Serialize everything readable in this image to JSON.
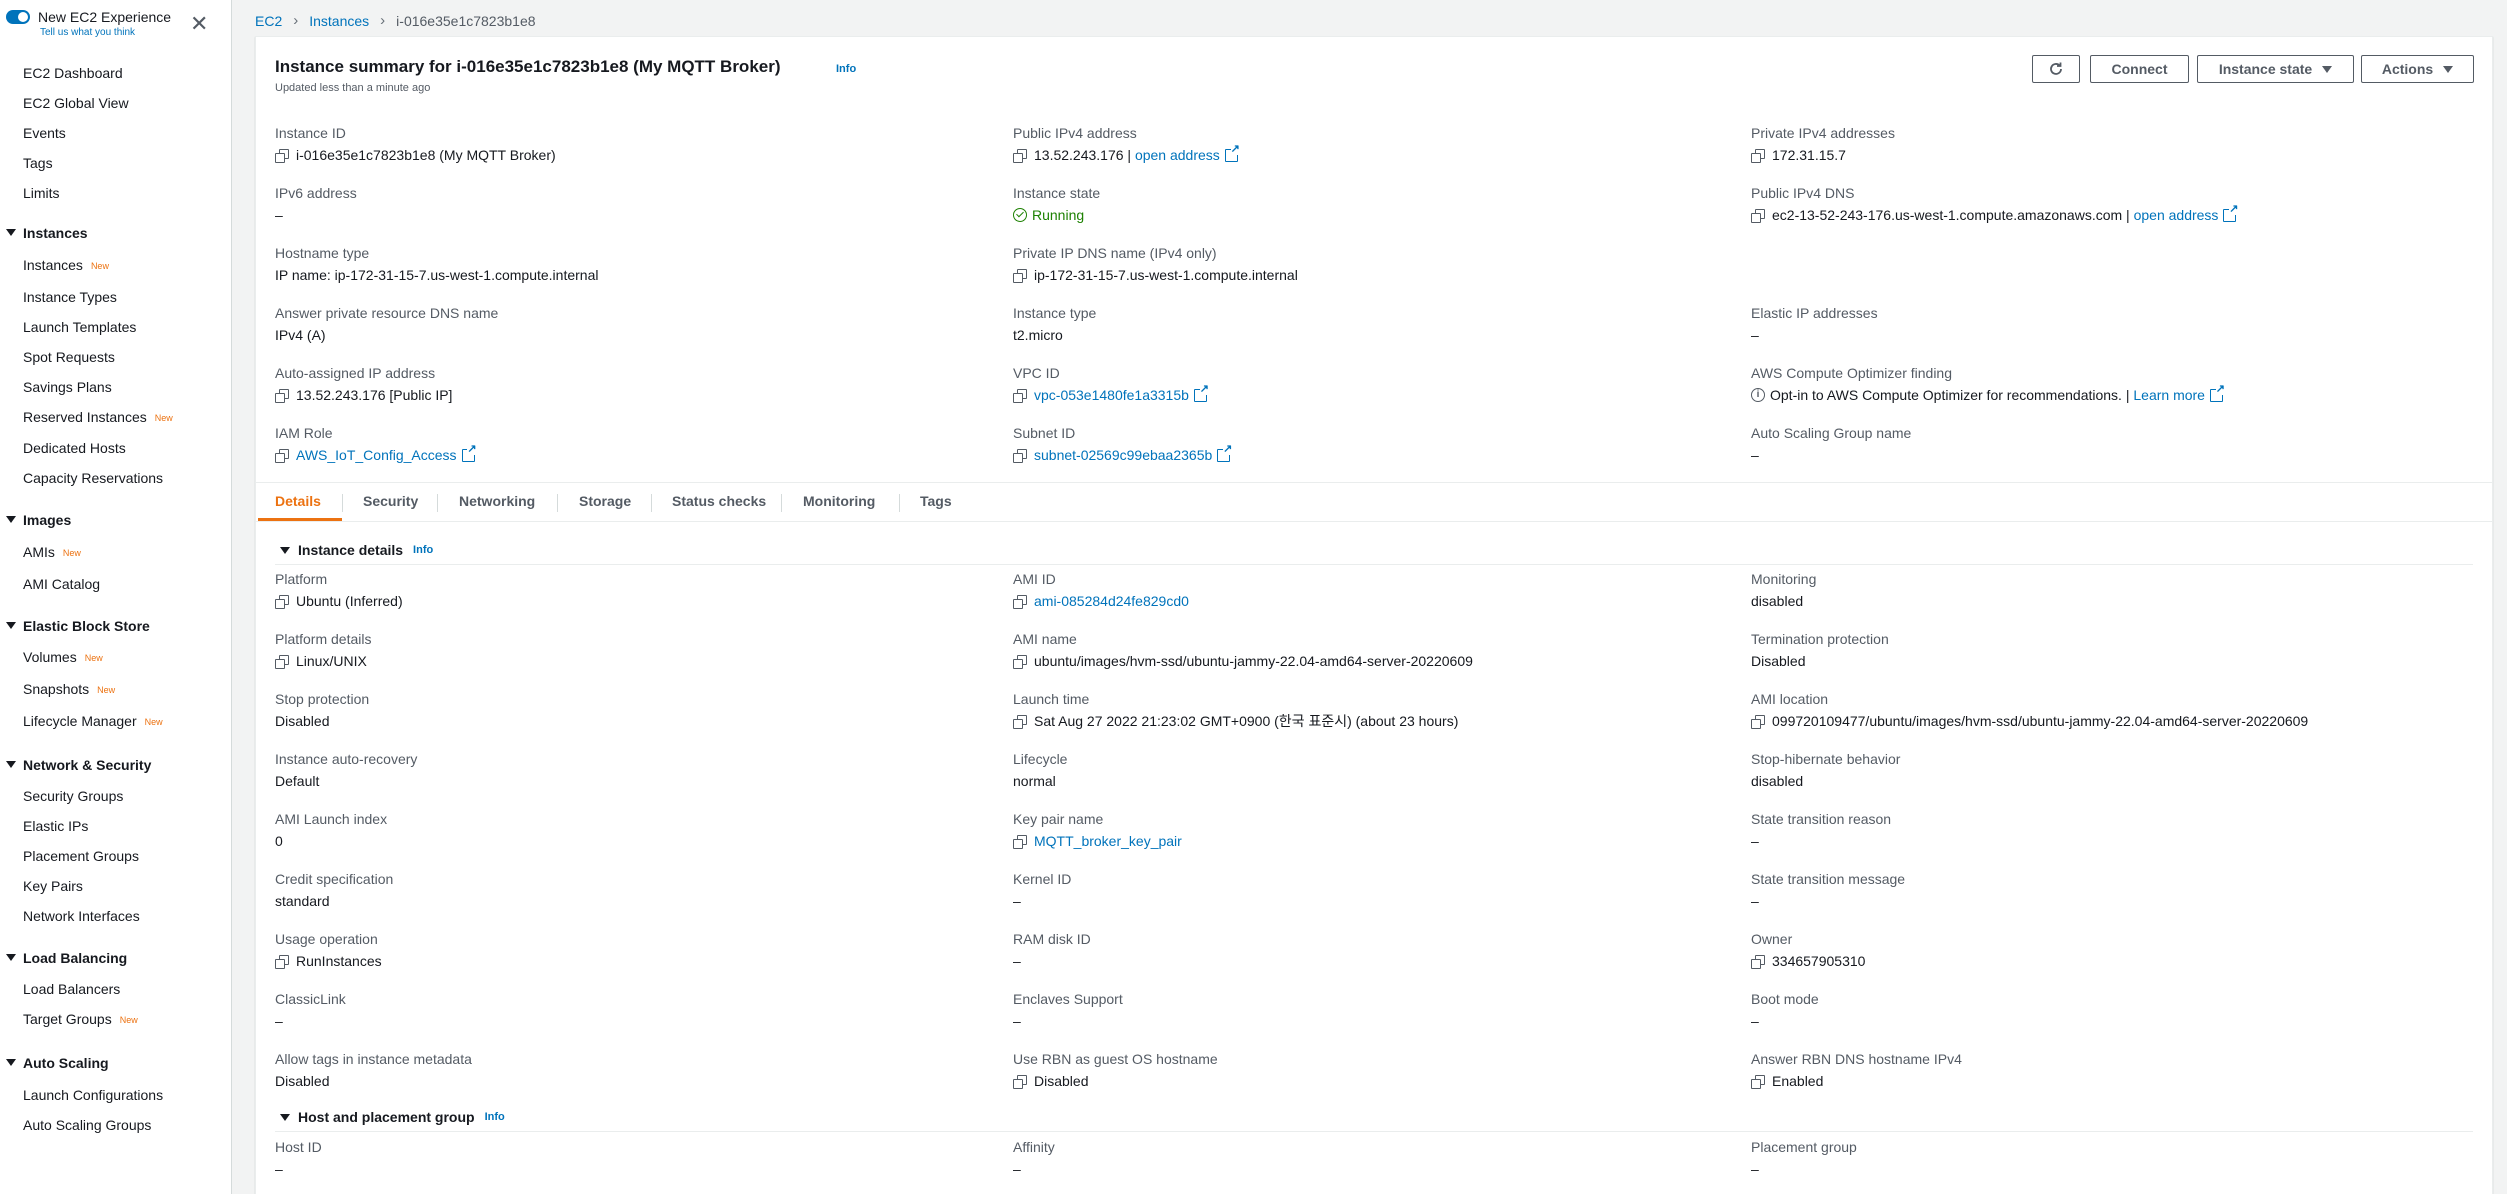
{
  "sidebar": {
    "new_experience": {
      "title": "New EC2 Experience",
      "subtitle": "Tell us what you think"
    },
    "items": [
      {
        "label": "EC2 Dashboard"
      },
      {
        "label": "EC2 Global View"
      },
      {
        "label": "Events"
      },
      {
        "label": "Tags"
      },
      {
        "label": "Limits"
      }
    ],
    "sections": [
      {
        "title": "Instances",
        "items": [
          {
            "label": "Instances",
            "badge": "New"
          },
          {
            "label": "Instance Types"
          },
          {
            "label": "Launch Templates"
          },
          {
            "label": "Spot Requests"
          },
          {
            "label": "Savings Plans"
          },
          {
            "label": "Reserved Instances",
            "badge": "New"
          },
          {
            "label": "Dedicated Hosts"
          },
          {
            "label": "Capacity Reservations"
          }
        ]
      },
      {
        "title": "Images",
        "items": [
          {
            "label": "AMIs",
            "badge": "New"
          },
          {
            "label": "AMI Catalog"
          }
        ]
      },
      {
        "title": "Elastic Block Store",
        "items": [
          {
            "label": "Volumes",
            "badge": "New"
          },
          {
            "label": "Snapshots",
            "badge": "New"
          },
          {
            "label": "Lifecycle Manager",
            "badge": "New"
          }
        ]
      },
      {
        "title": "Network & Security",
        "items": [
          {
            "label": "Security Groups"
          },
          {
            "label": "Elastic IPs"
          },
          {
            "label": "Placement Groups"
          },
          {
            "label": "Key Pairs"
          },
          {
            "label": "Network Interfaces"
          }
        ]
      },
      {
        "title": "Load Balancing",
        "items": [
          {
            "label": "Load Balancers"
          },
          {
            "label": "Target Groups",
            "badge": "New"
          }
        ]
      },
      {
        "title": "Auto Scaling",
        "items": [
          {
            "label": "Launch Configurations"
          },
          {
            "label": "Auto Scaling Groups"
          }
        ]
      }
    ]
  },
  "breadcrumb": [
    "EC2",
    "Instances",
    "i-016e35e1c7823b1e8"
  ],
  "summary": {
    "title": "Instance summary for i-016e35e1c7823b1e8 (My MQTT Broker)",
    "info": "Info",
    "updated": "Updated less than a minute ago",
    "buttons": {
      "connect": "Connect",
      "instance_state": "Instance state",
      "actions": "Actions"
    },
    "fields": {
      "instance_id": {
        "label": "Instance ID",
        "value": "i-016e35e1c7823b1e8 (My MQTT Broker)"
      },
      "public_ipv4": {
        "label": "Public IPv4 address",
        "value": "13.52.243.176",
        "sep": " | ",
        "link": "open address"
      },
      "private_ipv4": {
        "label": "Private IPv4 addresses",
        "value": "172.31.15.7"
      },
      "ipv6": {
        "label": "IPv6 address",
        "value": "–"
      },
      "instance_state": {
        "label": "Instance state",
        "value": "Running"
      },
      "public_dns": {
        "label": "Public IPv4 DNS",
        "value": "ec2-13-52-243-176.us-west-1.compute.amazonaws.com",
        "sep": " | ",
        "link": "open address"
      },
      "hostname_type": {
        "label": "Hostname type",
        "value": "IP name: ip-172-31-15-7.us-west-1.compute.internal"
      },
      "private_dns": {
        "label": "Private IP DNS name (IPv4 only)",
        "value": "ip-172-31-15-7.us-west-1.compute.internal"
      },
      "answer_dns": {
        "label": "Answer private resource DNS name",
        "value": "IPv4 (A)"
      },
      "instance_type": {
        "label": "Instance type",
        "value": "t2.micro"
      },
      "elastic_ip": {
        "label": "Elastic IP addresses",
        "value": "–"
      },
      "auto_ip": {
        "label": "Auto-assigned IP address",
        "value": "13.52.243.176 [Public IP]"
      },
      "vpc_id": {
        "label": "VPC ID",
        "value": "vpc-053e1480fe1a3315b"
      },
      "optimizer": {
        "label": "AWS Compute Optimizer finding",
        "value": "Opt-in to AWS Compute Optimizer for recommendations.",
        "sep": " | ",
        "link": "Learn more"
      },
      "iam_role": {
        "label": "IAM Role",
        "value": "AWS_IoT_Config_Access"
      },
      "subnet_id": {
        "label": "Subnet ID",
        "value": "subnet-02569c99ebaa2365b"
      },
      "asg_name": {
        "label": "Auto Scaling Group name",
        "value": "–"
      }
    }
  },
  "tabs": [
    "Details",
    "Security",
    "Networking",
    "Storage",
    "Status checks",
    "Monitoring",
    "Tags"
  ],
  "instance_details": {
    "title": "Instance details",
    "info": "Info",
    "fields": {
      "platform": {
        "label": "Platform",
        "value": "Ubuntu (Inferred)"
      },
      "ami_id": {
        "label": "AMI ID",
        "value": "ami-085284d24fe829cd0"
      },
      "monitoring": {
        "label": "Monitoring",
        "value": "disabled"
      },
      "platform_details": {
        "label": "Platform details",
        "value": "Linux/UNIX"
      },
      "ami_name": {
        "label": "AMI name",
        "value": "ubuntu/images/hvm-ssd/ubuntu-jammy-22.04-amd64-server-20220609"
      },
      "termination": {
        "label": "Termination protection",
        "value": "Disabled"
      },
      "stop_protection": {
        "label": "Stop protection",
        "value": "Disabled"
      },
      "launch_time": {
        "label": "Launch time",
        "value": "Sat Aug 27 2022 21:23:02 GMT+0900 (한국 표준시) (about 23 hours)"
      },
      "ami_location": {
        "label": "AMI location",
        "value": "099720109477/ubuntu/images/hvm-ssd/ubuntu-jammy-22.04-amd64-server-20220609"
      },
      "auto_recovery": {
        "label": "Instance auto-recovery",
        "value": "Default"
      },
      "lifecycle": {
        "label": "Lifecycle",
        "value": "normal"
      },
      "stop_hibernate": {
        "label": "Stop-hibernate behavior",
        "value": "disabled"
      },
      "ami_launch_index": {
        "label": "AMI Launch index",
        "value": "0"
      },
      "key_pair": {
        "label": "Key pair name",
        "value": "MQTT_broker_key_pair"
      },
      "state_reason": {
        "label": "State transition reason",
        "value": "–"
      },
      "credit_spec": {
        "label": "Credit specification",
        "value": "standard"
      },
      "kernel_id": {
        "label": "Kernel ID",
        "value": "–"
      },
      "state_message": {
        "label": "State transition message",
        "value": "–"
      },
      "usage_op": {
        "label": "Usage operation",
        "value": "RunInstances"
      },
      "ram_disk": {
        "label": "RAM disk ID",
        "value": "–"
      },
      "owner": {
        "label": "Owner",
        "value": "334657905310"
      },
      "classiclink": {
        "label": "ClassicLink",
        "value": "–"
      },
      "enclaves": {
        "label": "Enclaves Support",
        "value": "–"
      },
      "boot_mode": {
        "label": "Boot mode",
        "value": "–"
      },
      "allow_tags": {
        "label": "Allow tags in instance metadata",
        "value": "Disabled"
      },
      "rbn_hostname": {
        "label": "Use RBN as guest OS hostname",
        "value": "Disabled"
      },
      "answer_rbn": {
        "label": "Answer RBN DNS hostname IPv4",
        "value": "Enabled"
      }
    }
  },
  "host_placement": {
    "title": "Host and placement group",
    "info": "Info",
    "fields": {
      "host_id": {
        "label": "Host ID",
        "value": "–"
      },
      "affinity": {
        "label": "Affinity",
        "value": "–"
      },
      "placement_group": {
        "label": "Placement group",
        "value": "–"
      }
    }
  },
  "colors": {
    "accent": "#ec7211",
    "link": "#0073bb",
    "success": "#1d8102",
    "text": "#16191f",
    "muted": "#545b64"
  },
  "icons": [
    "toggle-switch",
    "close-icon",
    "chevron-right-icon",
    "refresh-icon",
    "copy-icon",
    "external-link-icon",
    "check-circle-icon",
    "info-circle-icon",
    "caret-down-icon"
  ]
}
